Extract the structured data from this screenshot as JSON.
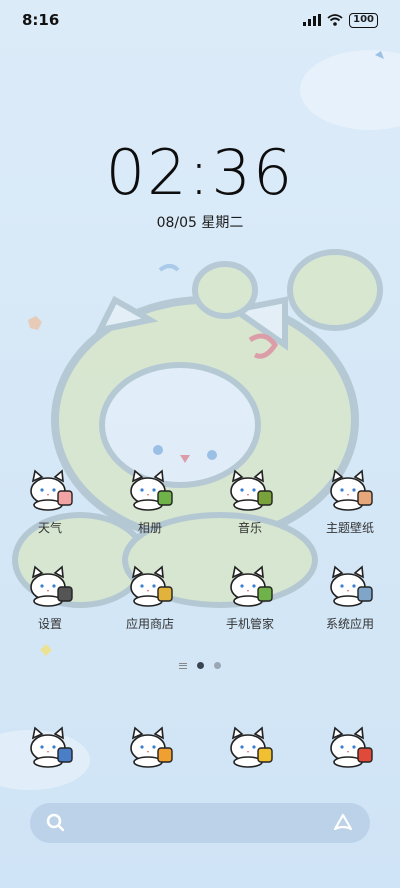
{
  "status": {
    "time": "8:16",
    "battery": "100",
    "signal_icon": "signal-icon",
    "wifi_icon": "wifi-icon"
  },
  "lock": {
    "clock": "02:36",
    "date": "08/05 星期二"
  },
  "apps": [
    {
      "label": "天气",
      "icon": "weather-icon",
      "accent": "#f2a3a3"
    },
    {
      "label": "相册",
      "icon": "gallery-icon",
      "accent": "#6fb24a"
    },
    {
      "label": "音乐",
      "icon": "music-icon",
      "accent": "#7aa23a"
    },
    {
      "label": "主题壁纸",
      "icon": "theme-icon",
      "accent": "#e6a77a"
    },
    {
      "label": "设置",
      "icon": "settings-icon",
      "accent": "#555555"
    },
    {
      "label": "应用商店",
      "icon": "app-store-icon",
      "accent": "#e2b33a"
    },
    {
      "label": "手机管家",
      "icon": "security-icon",
      "accent": "#6fb24a"
    },
    {
      "label": "系统应用",
      "icon": "system-apps-folder-icon",
      "accent": "#7fa6c8"
    }
  ],
  "dock": [
    {
      "icon": "phone-icon",
      "accent": "#4a7fc8"
    },
    {
      "icon": "browser-icon",
      "accent": "#f0a030"
    },
    {
      "icon": "messages-icon",
      "accent": "#f0c030"
    },
    {
      "icon": "camera-icon",
      "accent": "#e04a3a"
    }
  ],
  "search": {
    "icon": "search-icon",
    "assistant_icon": "assistant-icon"
  }
}
